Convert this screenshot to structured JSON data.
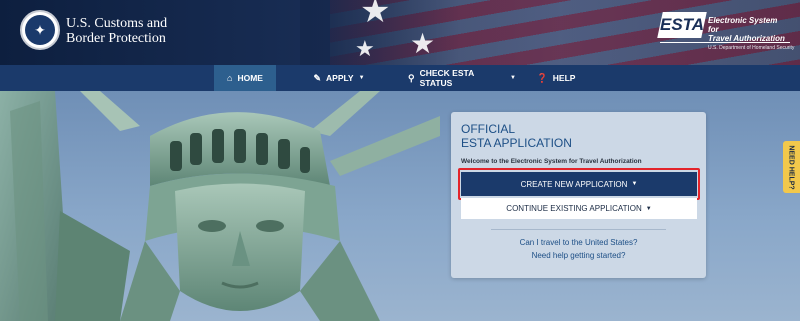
{
  "header": {
    "agency_line1": "U.S. Customs and",
    "agency_line2": "Border Protection",
    "esta_logo_text": "ESTA",
    "esta_desc_line1": "Electronic System for",
    "esta_desc_line2": "Travel Authorization",
    "esta_dept": "U.S. Department of Homeland Security"
  },
  "nav": {
    "items": [
      {
        "label": "HOME",
        "icon": "home-icon"
      },
      {
        "label": "APPLY",
        "icon": "pencil-icon"
      },
      {
        "label": "CHECK ESTA STATUS",
        "icon": "search-icon"
      },
      {
        "label": "HELP",
        "icon": "question-icon"
      }
    ]
  },
  "panel": {
    "title_line1": "OFFICIAL",
    "title_line2": "ESTA APPLICATION",
    "welcome": "Welcome to the Electronic System for Travel Authorization",
    "create_button": "CREATE NEW APPLICATION",
    "continue_button": "CONTINUE EXISTING APPLICATION",
    "link1": "Can I travel to the United States?",
    "link2": "Need help getting started?"
  },
  "need_help_tab": "NEED HELP?",
  "colors": {
    "nav_bg": "#1b3a6b",
    "nav_active": "#2d5f8e",
    "panel_bg": "#ccd8e6",
    "highlight": "#e3242b",
    "help_tab": "#f2c84b"
  }
}
